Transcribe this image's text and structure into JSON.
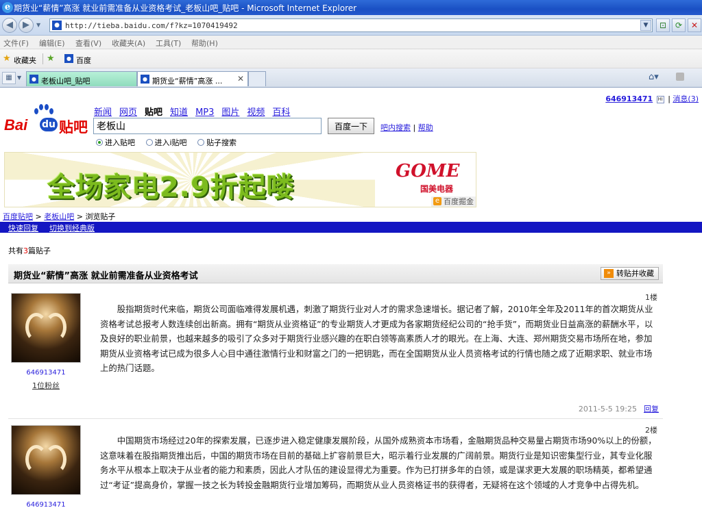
{
  "browser": {
    "window_title": "期货业“薪情”高涨 就业前需准备从业资格考试_老板山吧_贴吧 - Microsoft Internet Explorer",
    "url": "http://tieba.baidu.com/f?kz=1070419492",
    "menu": [
      "文件(F)",
      "编辑(E)",
      "查看(V)",
      "收藏夹(A)",
      "工具(T)",
      "帮助(H)"
    ],
    "favorites_label": "收藏夹",
    "fav_link": "百度",
    "tabs": [
      {
        "label": "老板山吧_贴吧"
      },
      {
        "label": "期货业“薪情”高涨 ..."
      }
    ]
  },
  "user": {
    "name": "646913471",
    "hi_icon": "Hi",
    "messages": "消息(3)"
  },
  "header": {
    "logo": {
      "bai": "Bai",
      "du": "du",
      "tieba": "贴吧"
    },
    "channels": [
      "新闻",
      "网页",
      "贴吧",
      "知道",
      "MP3",
      "图片",
      "视频",
      "百科"
    ],
    "current_channel": "贴吧",
    "search_value": "老板山",
    "search_button": "百度一下",
    "links": [
      "吧内搜索",
      "帮助"
    ],
    "radio_options": [
      "进入贴吧",
      "进入i贴吧",
      "贴子搜索"
    ],
    "radio_selected": "进入贴吧"
  },
  "banner": {
    "text": "全场家电2.9折起喽",
    "brand_logo": "GOME",
    "brand_cn": "国美电器",
    "ad_tag": "百度掘金"
  },
  "breadcrumb": [
    "百度贴吧",
    "老板山吧",
    "浏览贴子"
  ],
  "toolbar": {
    "quick_reply": "快速回复",
    "classic": "切换到经典版"
  },
  "thread": {
    "count_prefix": "共有",
    "count": "3",
    "count_suffix": "篇贴子",
    "title": "期货业“薪情”高涨 就业前需准备从业资格考试",
    "forward_button": "转贴并收藏"
  },
  "posts": [
    {
      "floor": "1楼",
      "author": "646913471",
      "fans": "1位粉丝",
      "content": "股指期货时代来临，期货公司面临难得发展机遇，刺激了期货行业对人才的需求急速增长。据记者了解，2010年全年及2011年的首次期货从业资格考试总报考人数连续创出新高。拥有“期货从业资格证”的专业期货人才更成为各家期货经纪公司的“抢手货”，而期货业日益高涨的薪酬水平，以及良好的职业前景，也越来越多的吸引了众多对于期货行业感兴趣的在职白领等高素质人才的眼光。在上海、大连、郑州期货交易市场所在地，参加期货从业资格考试已成为很多人心目中通往激情行业和财富之门的一把钥匙，而在全国期货从业人员资格考试的行情也随之成了近期求职、就业市场上的热门话题。",
      "time": "2011-5-5 19:25",
      "reply": "回复"
    },
    {
      "floor": "2楼",
      "author": "646913471",
      "content": "中国期货市场经过20年的探索发展，已逐步进入稳定健康发展阶段，从国外成熟资本市场看，金融期货品种交易量占期货市场90%以上的份额，这意味着在股指期货推出后，中国的期货市场在目前的基础上扩容前景巨大，昭示着行业发展的广阔前景。期货行业是知识密集型行业，其专业化服务水平从根本上取决于从业者的能力和素质，因此人才队伍的建设显得尤为重要。作为已打拼多年的白领，或是谋求更大发展的职场精英，都希望通过“考证”提高身价，掌握一技之长为转投金融期货行业增加筹码，而期货从业人员资格证书的获得者，无疑将在这个领域的人才竞争中占得先机。"
    }
  ],
  "colors": {
    "link": "#261cdc",
    "nav_bar": "#1416c2",
    "logo_red": "#e10602",
    "logo_blue": "#1b4ec6"
  }
}
